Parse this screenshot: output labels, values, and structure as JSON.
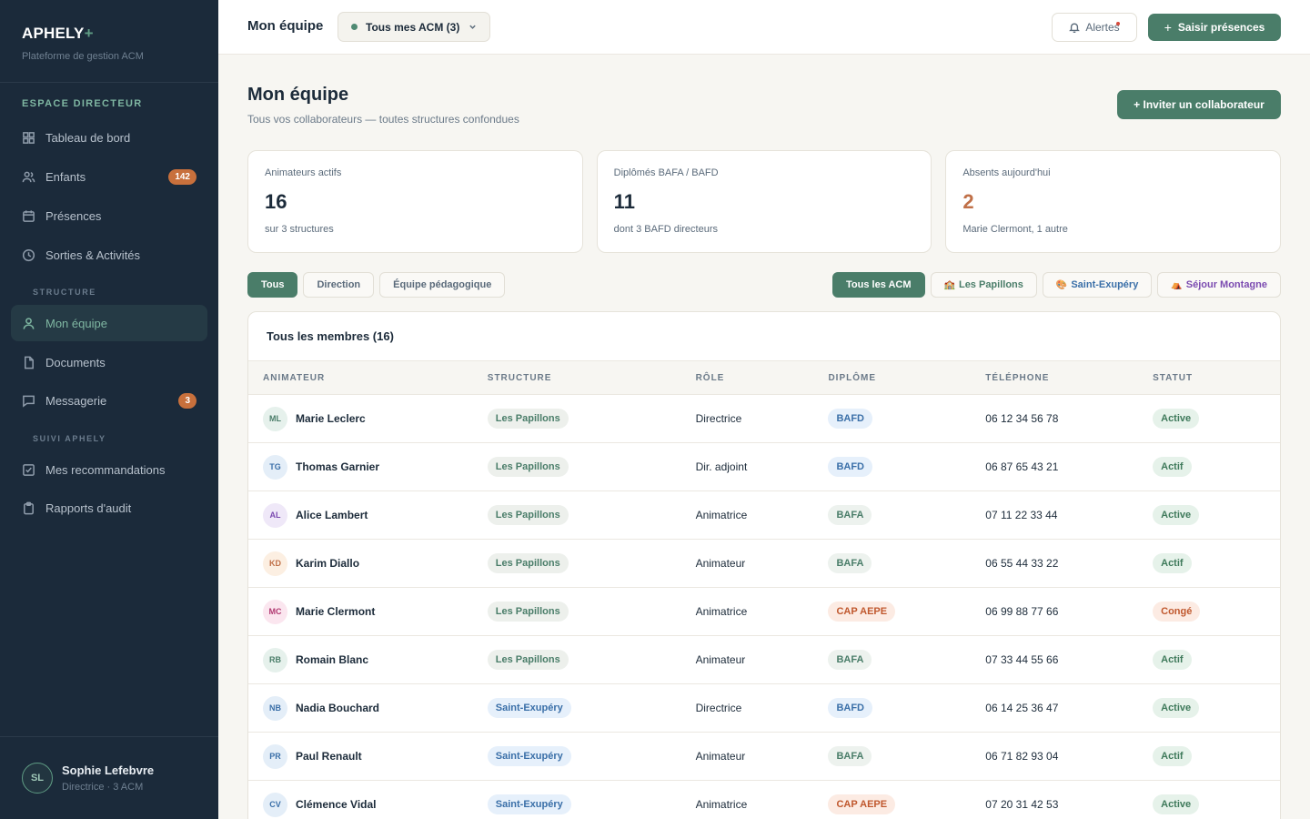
{
  "brand": {
    "name": "APHELY",
    "plus": "+",
    "subtitle": "Plateforme de gestion ACM"
  },
  "sidebar": {
    "section": "ESPACE DIRECTEUR",
    "groups": {
      "structure": "STRUCTURE",
      "suivi": "SUIVI APHELY"
    },
    "items": [
      {
        "label": "Tableau de bord",
        "icon": "grid-icon"
      },
      {
        "label": "Enfants",
        "icon": "users-icon",
        "badge": "142"
      },
      {
        "label": "Présences",
        "icon": "calendar-icon"
      },
      {
        "label": "Sorties & Activités",
        "icon": "clock-icon"
      },
      {
        "label": "Mon équipe",
        "icon": "user-icon",
        "active": true
      },
      {
        "label": "Documents",
        "icon": "document-icon"
      },
      {
        "label": "Messagerie",
        "icon": "message-icon",
        "badge": "3"
      },
      {
        "label": "Mes recommandations",
        "icon": "checkbox-icon"
      },
      {
        "label": "Rapports d'audit",
        "icon": "clipboard-icon"
      }
    ]
  },
  "profile": {
    "initials": "SL",
    "name": "Sophie Lefebvre",
    "role": "Directrice · 3 ACM"
  },
  "topbar": {
    "title": "Mon équipe",
    "acm_select": "Tous mes ACM (3)",
    "alerts": "Alertes",
    "presence_button": "Saisir présences",
    "presence_plus": "+"
  },
  "page": {
    "title": "Mon équipe",
    "subtitle": "Tous vos collaborateurs — toutes structures confondues",
    "invite_button": "+ Inviter un collaborateur"
  },
  "stats": [
    {
      "label": "Animateurs actifs",
      "value": "16",
      "foot": "sur 3 structures"
    },
    {
      "label": "Diplômés BAFA / BAFD",
      "value": "11",
      "foot": "dont 3 BAFD directeurs"
    },
    {
      "label": "Absents aujourd'hui",
      "value": "2",
      "foot": "Marie Clermont, 1 autre"
    }
  ],
  "filters": {
    "roles": [
      "Tous",
      "Direction",
      "Équipe pédagogique"
    ],
    "structures": [
      {
        "label": "Tous les ACM",
        "emoji": ""
      },
      {
        "label": "Les Papillons",
        "emoji": "🏫"
      },
      {
        "label": "Saint-Exupéry",
        "emoji": "🎨"
      },
      {
        "label": "Séjour Montagne",
        "emoji": "⛺"
      }
    ]
  },
  "table": {
    "title": "Tous les membres (16)",
    "headers": [
      "ANIMATEUR",
      "STRUCTURE",
      "RÔLE",
      "DIPLÔME",
      "TÉLÉPHONE",
      "STATUT"
    ],
    "rows": [
      {
        "initials": "ML",
        "name": "Marie Leclerc",
        "structure": "Les Papillons",
        "role": "Directrice",
        "diploma": "BAFD",
        "phone": "06 12 34 56 78",
        "status": "Active"
      },
      {
        "initials": "TG",
        "name": "Thomas Garnier",
        "structure": "Les Papillons",
        "role": "Dir. adjoint",
        "diploma": "BAFD",
        "phone": "06 87 65 43 21",
        "status": "Actif"
      },
      {
        "initials": "AL",
        "name": "Alice Lambert",
        "structure": "Les Papillons",
        "role": "Animatrice",
        "diploma": "BAFA",
        "phone": "07 11 22 33 44",
        "status": "Active"
      },
      {
        "initials": "KD",
        "name": "Karim Diallo",
        "structure": "Les Papillons",
        "role": "Animateur",
        "diploma": "BAFA",
        "phone": "06 55 44 33 22",
        "status": "Actif"
      },
      {
        "initials": "MC",
        "name": "Marie Clermont",
        "structure": "Les Papillons",
        "role": "Animatrice",
        "diploma": "CAP AEPE",
        "phone": "06 99 88 77 66",
        "status": "Congé"
      },
      {
        "initials": "RB",
        "name": "Romain Blanc",
        "structure": "Les Papillons",
        "role": "Animateur",
        "diploma": "BAFA",
        "phone": "07 33 44 55 66",
        "status": "Actif"
      },
      {
        "initials": "NB",
        "name": "Nadia Bouchard",
        "structure": "Saint-Exupéry",
        "role": "Directrice",
        "diploma": "BAFD",
        "phone": "06 14 25 36 47",
        "status": "Active"
      },
      {
        "initials": "PR",
        "name": "Paul Renault",
        "structure": "Saint-Exupéry",
        "role": "Animateur",
        "diploma": "BAFA",
        "phone": "06 71 82 93 04",
        "status": "Actif"
      },
      {
        "initials": "CV",
        "name": "Clémence Vidal",
        "structure": "Saint-Exupéry",
        "role": "Animatrice",
        "diploma": "CAP AEPE",
        "phone": "07 20 31 42 53",
        "status": "Active"
      }
    ]
  },
  "colors": {
    "accent": "#4a7d69",
    "sidebar": "#1b2a3a",
    "warning": "#c07048"
  }
}
